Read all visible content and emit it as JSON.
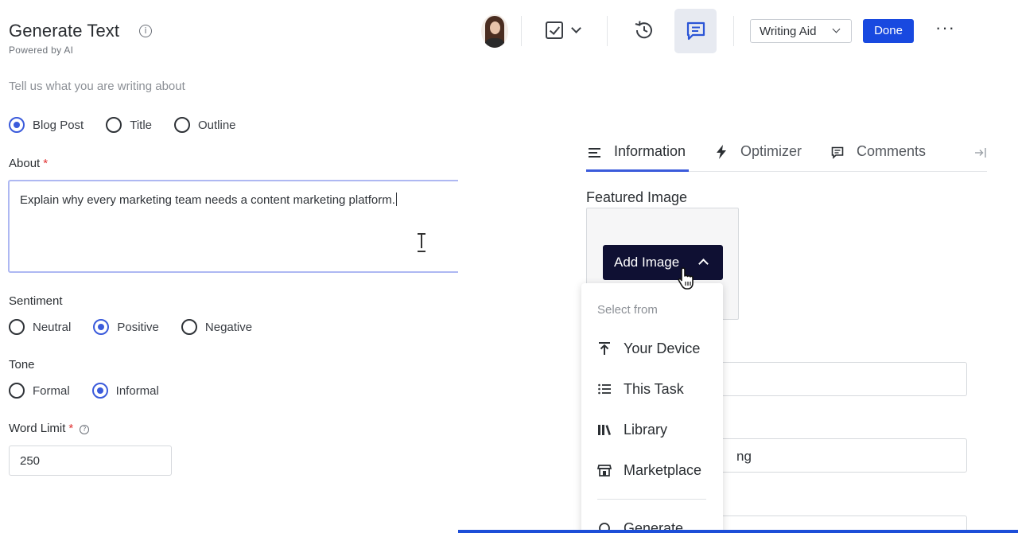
{
  "generate": {
    "title": "Generate Text",
    "subtitle": "Powered by AI",
    "prompt": "Tell us what you are writing about",
    "type_options": [
      {
        "label": "Blog Post",
        "selected": true
      },
      {
        "label": "Title",
        "selected": false
      },
      {
        "label": "Outline",
        "selected": false
      }
    ],
    "about_label": "About",
    "about_value": "Explain why every marketing team needs a content marketing platform.",
    "sentiment_label": "Sentiment",
    "sentiment_options": [
      {
        "label": "Neutral",
        "selected": false
      },
      {
        "label": "Positive",
        "selected": true
      },
      {
        "label": "Negative",
        "selected": false
      }
    ],
    "tone_label": "Tone",
    "tone_options": [
      {
        "label": "Formal",
        "selected": false
      },
      {
        "label": "Informal",
        "selected": true
      }
    ],
    "word_limit_label": "Word Limit",
    "word_limit_value": "250",
    "required_mark": "*",
    "info_glyph": "i",
    "help_glyph": "?"
  },
  "toolbar": {
    "writing_aid_label": "Writing Aid",
    "done_label": "Done",
    "more_label": "···"
  },
  "tabs": [
    {
      "label": "Information",
      "icon": "lines-icon",
      "active": true
    },
    {
      "label": "Optimizer",
      "icon": "lightning-icon",
      "active": false
    },
    {
      "label": "Comments",
      "icon": "comment-icon",
      "active": false
    }
  ],
  "featured": {
    "label": "Featured Image",
    "add_image_label": "Add Image"
  },
  "background_fields": [
    {
      "value": ""
    },
    {
      "value": "ng"
    },
    {
      "value": ""
    }
  ],
  "dropdown": {
    "header": "Select from",
    "items": [
      {
        "label": "Your Device",
        "icon": "upload-icon"
      },
      {
        "label": "This Task",
        "icon": "list-icon"
      },
      {
        "label": "Library",
        "icon": "library-icon"
      },
      {
        "label": "Marketplace",
        "icon": "store-icon"
      },
      {
        "label": "Generate",
        "icon": "sparkle-icon"
      }
    ]
  },
  "colors": {
    "accent": "#3b5bdb",
    "done_button": "#1849e0",
    "add_image_button": "#0f1033",
    "required": "#e03131"
  }
}
